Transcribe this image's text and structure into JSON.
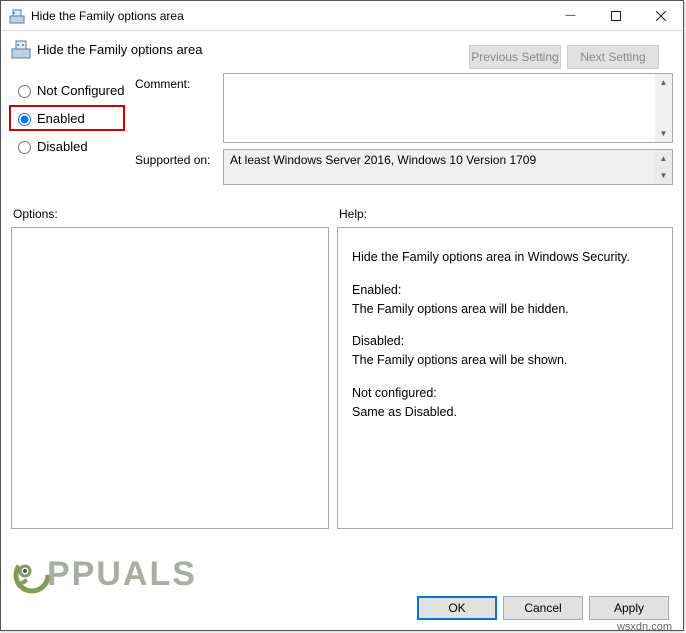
{
  "window": {
    "title": "Hide the Family options area",
    "controls": {
      "minimize": "—",
      "maximize": "▢",
      "close": "✕"
    }
  },
  "header": {
    "title": "Hide the Family options area",
    "prev_setting": "Previous Setting",
    "next_setting": "Next Setting"
  },
  "state": {
    "not_configured": "Not Configured",
    "enabled": "Enabled",
    "disabled": "Disabled"
  },
  "fields": {
    "comment_label": "Comment:",
    "comment_value": "",
    "supported_label": "Supported on:",
    "supported_value": "At least Windows Server 2016, Windows 10 Version 1709"
  },
  "lower": {
    "options_label": "Options:",
    "help_label": "Help:",
    "help_text_1": "Hide the Family options area in Windows Security.",
    "help_text_2a": "Enabled:",
    "help_text_2b": "The Family options area will be hidden.",
    "help_text_3a": "Disabled:",
    "help_text_3b": "The Family options area will be shown.",
    "help_text_4a": "Not configured:",
    "help_text_4b": "Same as Disabled."
  },
  "footer": {
    "ok": "OK",
    "cancel": "Cancel",
    "apply": "Apply"
  },
  "watermark": {
    "text": "PPUALS"
  },
  "site": "wsxdn.com"
}
